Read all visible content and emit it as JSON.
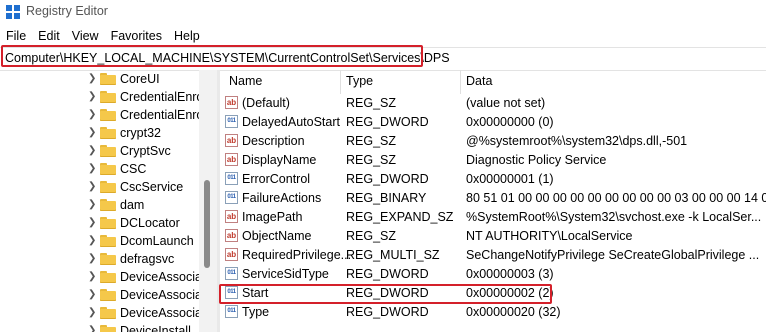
{
  "window": {
    "title": "Registry Editor"
  },
  "menu": [
    "File",
    "Edit",
    "View",
    "Favorites",
    "Help"
  ],
  "address": "Computer\\HKEY_LOCAL_MACHINE\\SYSTEM\\CurrentControlSet\\Services\\DPS",
  "tree": [
    "CoreUI",
    "CredentialEnro",
    "CredentialEnro",
    "crypt32",
    "CryptSvc",
    "CSC",
    "CscService",
    "dam",
    "DCLocator",
    "DcomLaunch",
    "defragsvc",
    "DeviceAssocia",
    "DeviceAssocia",
    "DeviceAssocia",
    "DeviceInstall"
  ],
  "columns": {
    "name": "Name",
    "type": "Type",
    "data": "Data"
  },
  "values": [
    {
      "icon": "string-value-icon",
      "name": "(Default)",
      "type": "REG_SZ",
      "data": "(value not set)"
    },
    {
      "icon": "binary-value-icon",
      "name": "DelayedAutoStart",
      "type": "REG_DWORD",
      "data": "0x00000000 (0)"
    },
    {
      "icon": "string-value-icon",
      "name": "Description",
      "type": "REG_SZ",
      "data": "@%systemroot%\\system32\\dps.dll,-501"
    },
    {
      "icon": "string-value-icon",
      "name": "DisplayName",
      "type": "REG_SZ",
      "data": "Diagnostic Policy Service"
    },
    {
      "icon": "binary-value-icon",
      "name": "ErrorControl",
      "type": "REG_DWORD",
      "data": "0x00000001 (1)"
    },
    {
      "icon": "binary-value-icon",
      "name": "FailureActions",
      "type": "REG_BINARY",
      "data": "80 51 01 00 00 00 00 00 00 00 00 00 03 00 00 00 14 00..."
    },
    {
      "icon": "string-value-icon",
      "name": "ImagePath",
      "type": "REG_EXPAND_SZ",
      "data": "%SystemRoot%\\System32\\svchost.exe -k LocalSer..."
    },
    {
      "icon": "string-value-icon",
      "name": "ObjectName",
      "type": "REG_SZ",
      "data": "NT AUTHORITY\\LocalService"
    },
    {
      "icon": "string-value-icon",
      "name": "RequiredPrivilege...",
      "type": "REG_MULTI_SZ",
      "data": "SeChangeNotifyPrivilege SeCreateGlobalPrivilege ..."
    },
    {
      "icon": "binary-value-icon",
      "name": "ServiceSidType",
      "type": "REG_DWORD",
      "data": "0x00000003 (3)"
    },
    {
      "icon": "binary-value-icon",
      "name": "Start",
      "type": "REG_DWORD",
      "data": "0x00000002 (2)"
    },
    {
      "icon": "binary-value-icon",
      "name": "Type",
      "type": "REG_DWORD",
      "data": "0x00000020 (32)"
    }
  ],
  "colors": {
    "highlight": "#d4202a",
    "folder": "#f5c84a"
  }
}
